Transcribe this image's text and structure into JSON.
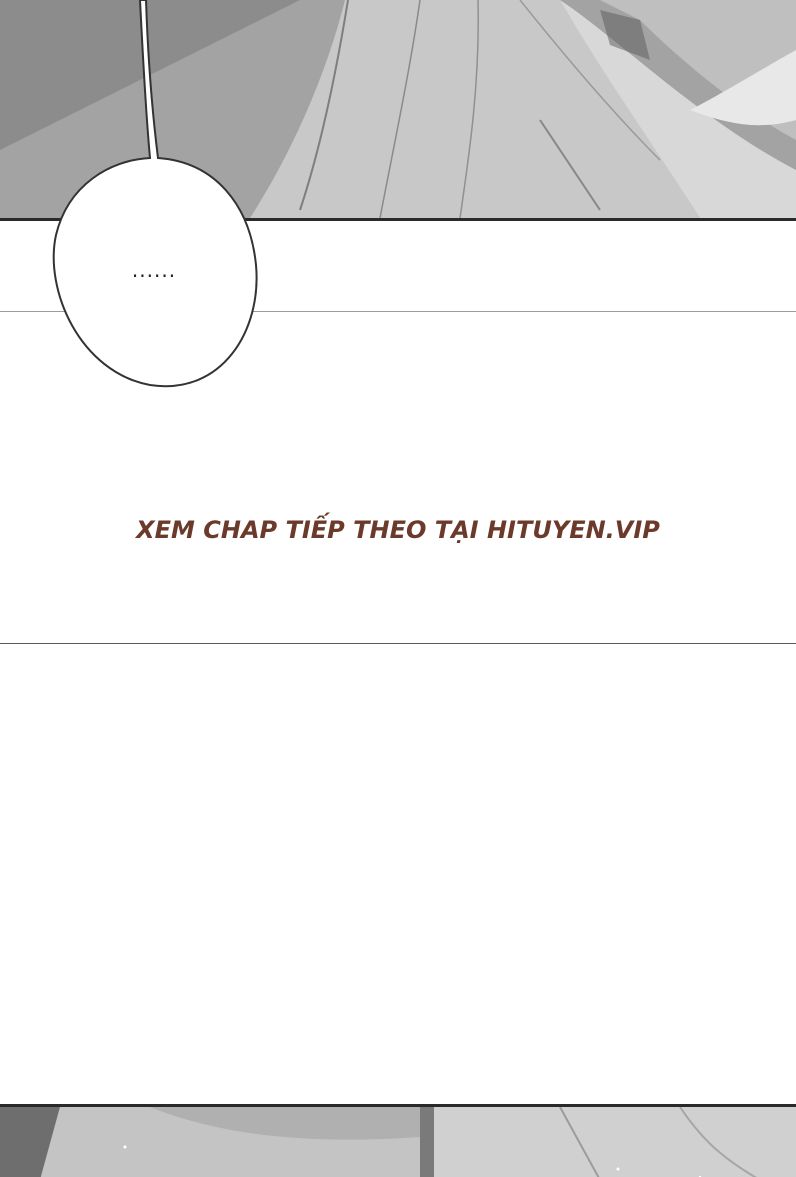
{
  "speech_bubble": {
    "text": "......"
  },
  "watermark": {
    "text": "XEM CHAP TIẾP THEO TẠI HITUYEN.VIP",
    "color": "#6b3a2a"
  },
  "colors": {
    "background": "#ffffff",
    "panel_border": "#2a2a2a",
    "artwork_gray": "#9a9a9a"
  }
}
